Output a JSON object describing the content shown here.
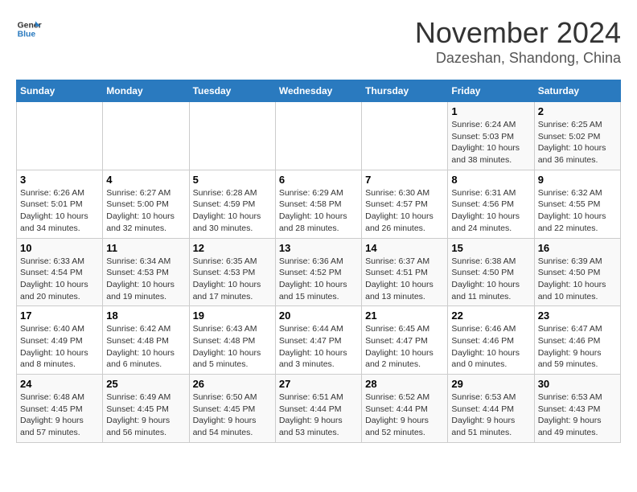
{
  "logo": {
    "line1": "General",
    "line2": "Blue"
  },
  "title": "November 2024",
  "subtitle": "Dazeshan, Shandong, China",
  "days_header": [
    "Sunday",
    "Monday",
    "Tuesday",
    "Wednesday",
    "Thursday",
    "Friday",
    "Saturday"
  ],
  "weeks": [
    [
      {
        "day": "",
        "info": ""
      },
      {
        "day": "",
        "info": ""
      },
      {
        "day": "",
        "info": ""
      },
      {
        "day": "",
        "info": ""
      },
      {
        "day": "",
        "info": ""
      },
      {
        "day": "1",
        "info": "Sunrise: 6:24 AM\nSunset: 5:03 PM\nDaylight: 10 hours\nand 38 minutes."
      },
      {
        "day": "2",
        "info": "Sunrise: 6:25 AM\nSunset: 5:02 PM\nDaylight: 10 hours\nand 36 minutes."
      }
    ],
    [
      {
        "day": "3",
        "info": "Sunrise: 6:26 AM\nSunset: 5:01 PM\nDaylight: 10 hours\nand 34 minutes."
      },
      {
        "day": "4",
        "info": "Sunrise: 6:27 AM\nSunset: 5:00 PM\nDaylight: 10 hours\nand 32 minutes."
      },
      {
        "day": "5",
        "info": "Sunrise: 6:28 AM\nSunset: 4:59 PM\nDaylight: 10 hours\nand 30 minutes."
      },
      {
        "day": "6",
        "info": "Sunrise: 6:29 AM\nSunset: 4:58 PM\nDaylight: 10 hours\nand 28 minutes."
      },
      {
        "day": "7",
        "info": "Sunrise: 6:30 AM\nSunset: 4:57 PM\nDaylight: 10 hours\nand 26 minutes."
      },
      {
        "day": "8",
        "info": "Sunrise: 6:31 AM\nSunset: 4:56 PM\nDaylight: 10 hours\nand 24 minutes."
      },
      {
        "day": "9",
        "info": "Sunrise: 6:32 AM\nSunset: 4:55 PM\nDaylight: 10 hours\nand 22 minutes."
      }
    ],
    [
      {
        "day": "10",
        "info": "Sunrise: 6:33 AM\nSunset: 4:54 PM\nDaylight: 10 hours\nand 20 minutes."
      },
      {
        "day": "11",
        "info": "Sunrise: 6:34 AM\nSunset: 4:53 PM\nDaylight: 10 hours\nand 19 minutes."
      },
      {
        "day": "12",
        "info": "Sunrise: 6:35 AM\nSunset: 4:53 PM\nDaylight: 10 hours\nand 17 minutes."
      },
      {
        "day": "13",
        "info": "Sunrise: 6:36 AM\nSunset: 4:52 PM\nDaylight: 10 hours\nand 15 minutes."
      },
      {
        "day": "14",
        "info": "Sunrise: 6:37 AM\nSunset: 4:51 PM\nDaylight: 10 hours\nand 13 minutes."
      },
      {
        "day": "15",
        "info": "Sunrise: 6:38 AM\nSunset: 4:50 PM\nDaylight: 10 hours\nand 11 minutes."
      },
      {
        "day": "16",
        "info": "Sunrise: 6:39 AM\nSunset: 4:50 PM\nDaylight: 10 hours\nand 10 minutes."
      }
    ],
    [
      {
        "day": "17",
        "info": "Sunrise: 6:40 AM\nSunset: 4:49 PM\nDaylight: 10 hours\nand 8 minutes."
      },
      {
        "day": "18",
        "info": "Sunrise: 6:42 AM\nSunset: 4:48 PM\nDaylight: 10 hours\nand 6 minutes."
      },
      {
        "day": "19",
        "info": "Sunrise: 6:43 AM\nSunset: 4:48 PM\nDaylight: 10 hours\nand 5 minutes."
      },
      {
        "day": "20",
        "info": "Sunrise: 6:44 AM\nSunset: 4:47 PM\nDaylight: 10 hours\nand 3 minutes."
      },
      {
        "day": "21",
        "info": "Sunrise: 6:45 AM\nSunset: 4:47 PM\nDaylight: 10 hours\nand 2 minutes."
      },
      {
        "day": "22",
        "info": "Sunrise: 6:46 AM\nSunset: 4:46 PM\nDaylight: 10 hours\nand 0 minutes."
      },
      {
        "day": "23",
        "info": "Sunrise: 6:47 AM\nSunset: 4:46 PM\nDaylight: 9 hours\nand 59 minutes."
      }
    ],
    [
      {
        "day": "24",
        "info": "Sunrise: 6:48 AM\nSunset: 4:45 PM\nDaylight: 9 hours\nand 57 minutes."
      },
      {
        "day": "25",
        "info": "Sunrise: 6:49 AM\nSunset: 4:45 PM\nDaylight: 9 hours\nand 56 minutes."
      },
      {
        "day": "26",
        "info": "Sunrise: 6:50 AM\nSunset: 4:45 PM\nDaylight: 9 hours\nand 54 minutes."
      },
      {
        "day": "27",
        "info": "Sunrise: 6:51 AM\nSunset: 4:44 PM\nDaylight: 9 hours\nand 53 minutes."
      },
      {
        "day": "28",
        "info": "Sunrise: 6:52 AM\nSunset: 4:44 PM\nDaylight: 9 hours\nand 52 minutes."
      },
      {
        "day": "29",
        "info": "Sunrise: 6:53 AM\nSunset: 4:44 PM\nDaylight: 9 hours\nand 51 minutes."
      },
      {
        "day": "30",
        "info": "Sunrise: 6:53 AM\nSunset: 4:43 PM\nDaylight: 9 hours\nand 49 minutes."
      }
    ]
  ]
}
